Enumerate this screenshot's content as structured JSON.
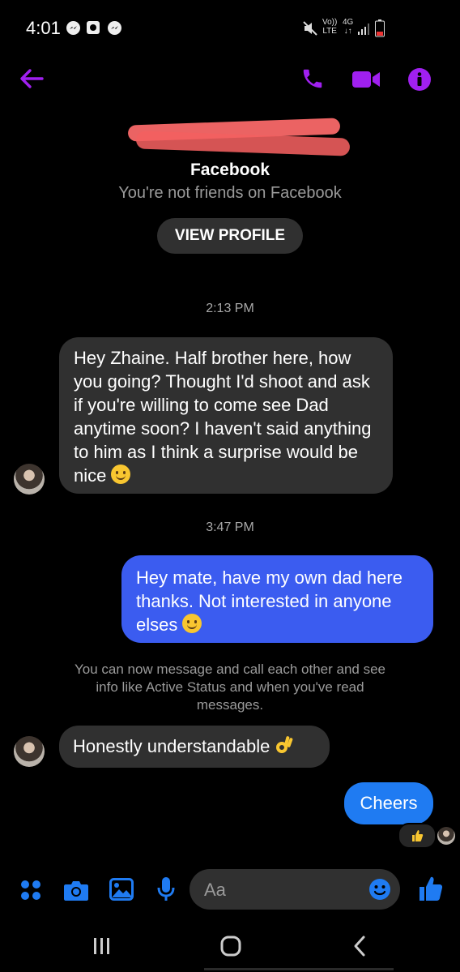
{
  "status_bar": {
    "time": "4:01",
    "volte": "Vo))",
    "lte": "LTE",
    "network": "4G"
  },
  "contact": {
    "subtitle_app": "Facebook",
    "relation": "You're not friends on Facebook",
    "view_profile_label": "VIEW PROFILE"
  },
  "messages": {
    "time1": "2:13 PM",
    "msg1": "Hey Zhaine. Half brother here, how you going? Thought I'd shoot and ask if you're willing to come see Dad anytime soon? I haven't said anything to him as I think a surprise would be nice",
    "time2": "3:47 PM",
    "msg2": "Hey mate, have my own dad here thanks. Not interested in anyone elses",
    "notice": "You can now message and call each other and see info like Active Status and when you've read messages.",
    "msg3": "Honestly understandable",
    "msg4": "Cheers"
  },
  "composer": {
    "placeholder": "Aa"
  },
  "colors": {
    "accent_purple": "#a020f0",
    "messenger_blue": "#1f7bf2",
    "outgoing_bubble": "#3b5cf0",
    "incoming_bubble": "#303030"
  }
}
